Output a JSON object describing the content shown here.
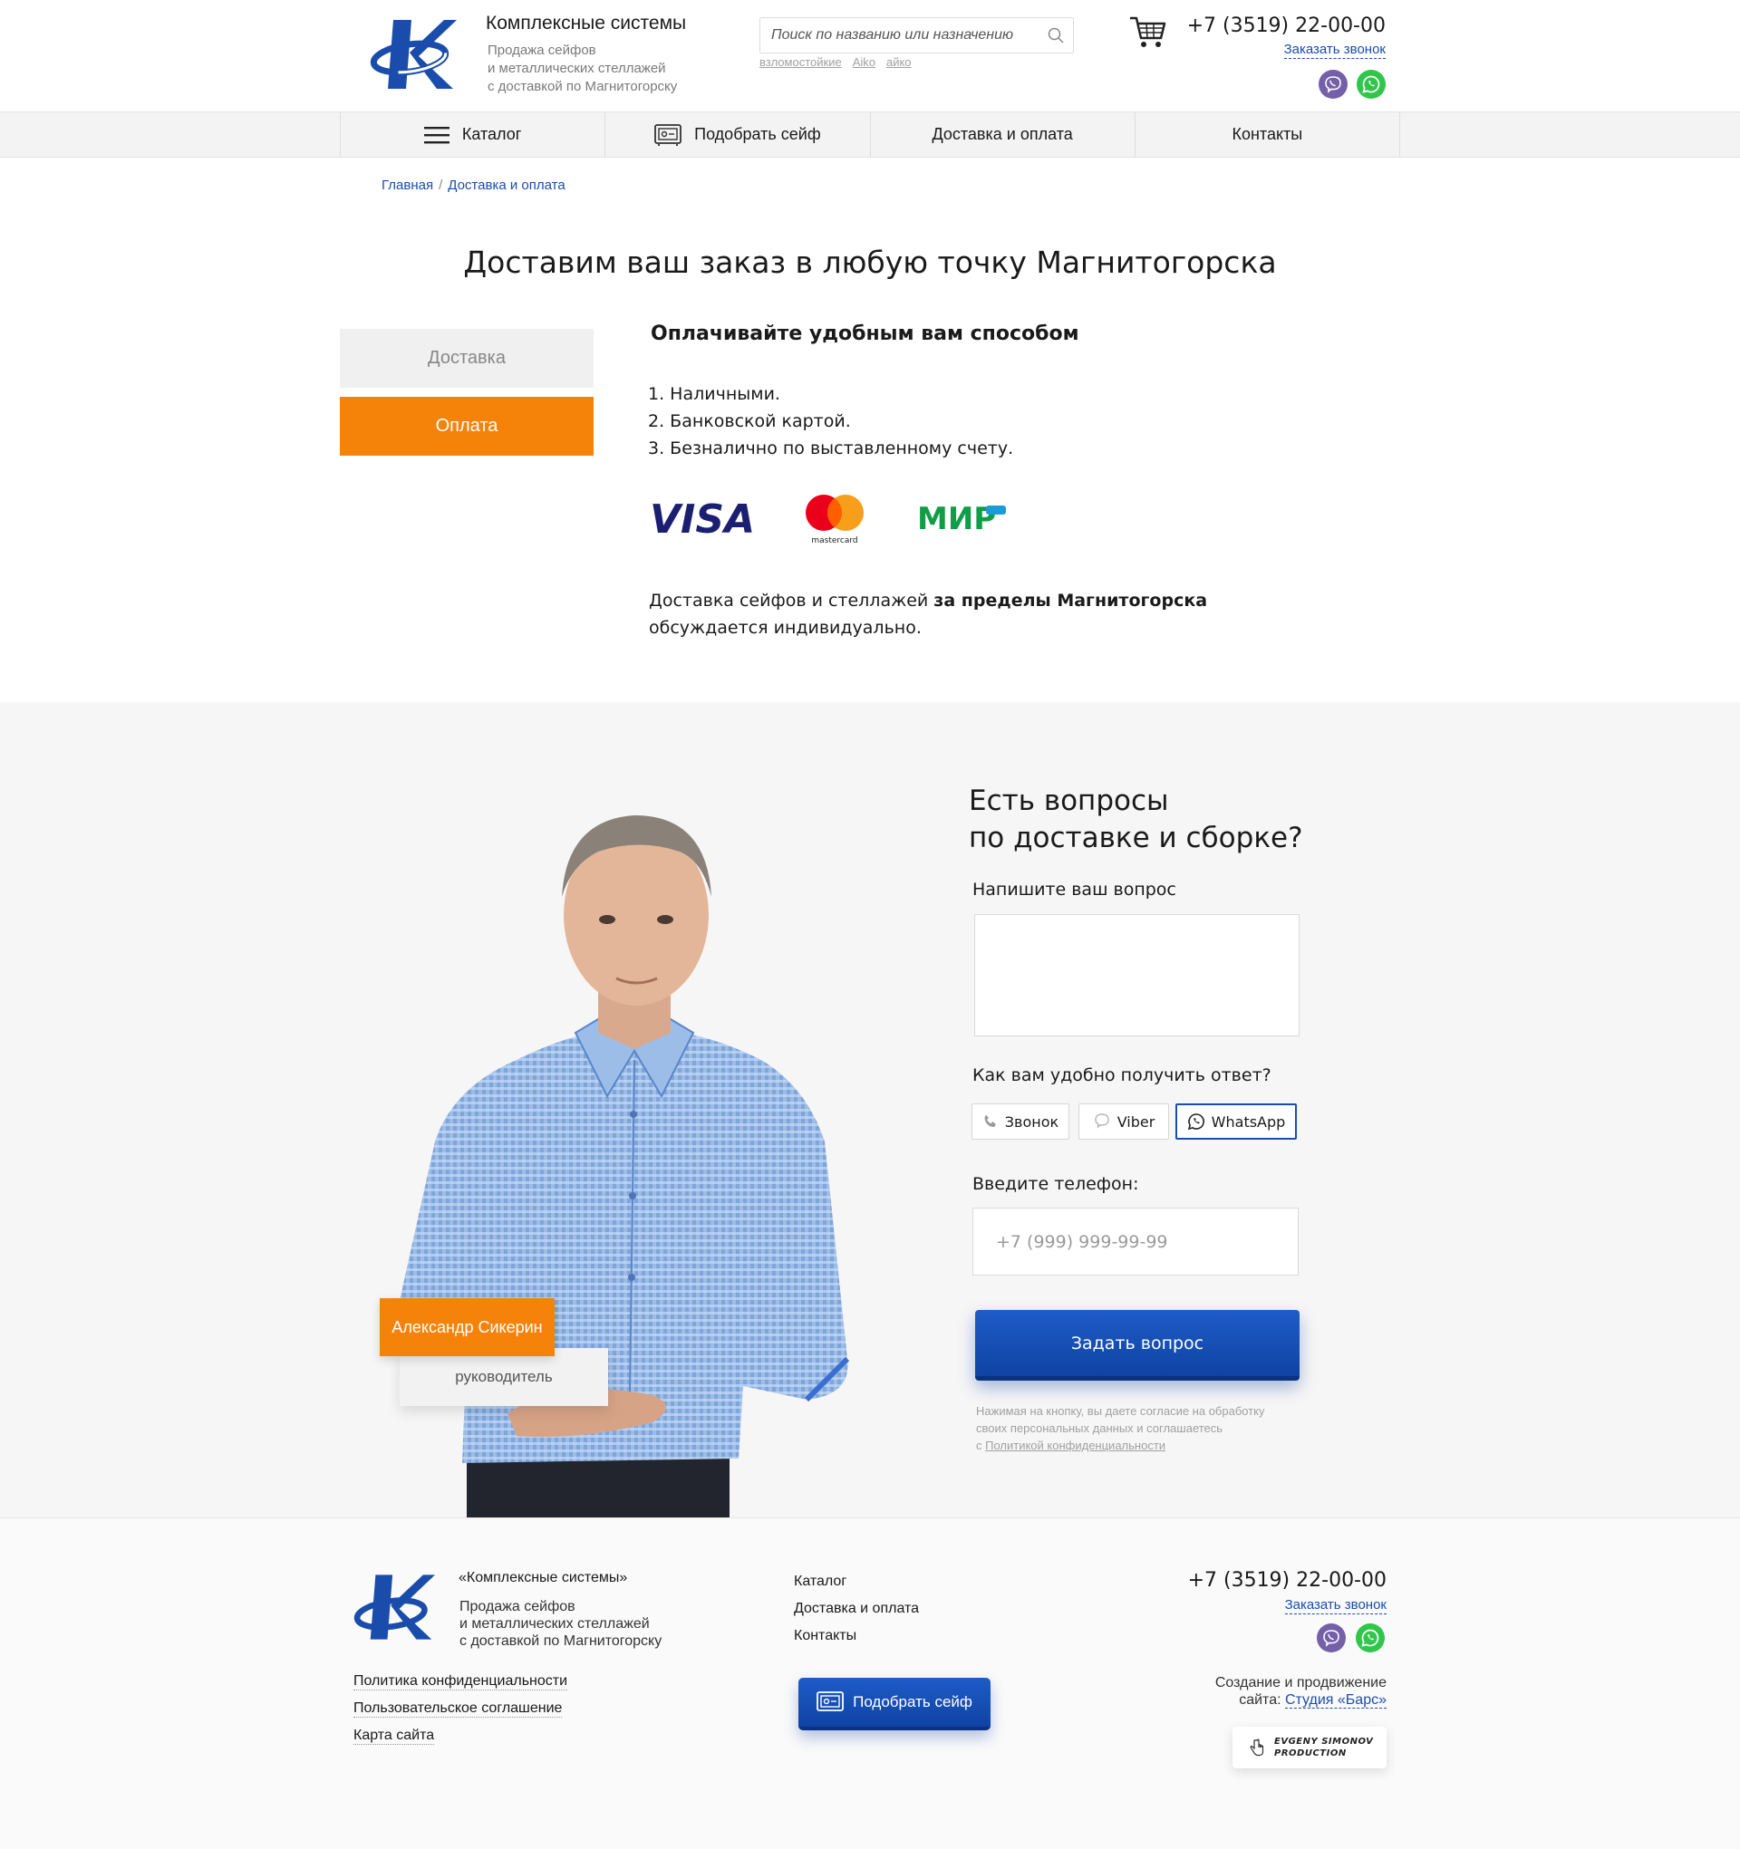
{
  "header": {
    "brand_title": "Комплексные системы",
    "brand_sub_1": "Продажа сейфов",
    "brand_sub_2": "и металлических стеллажей",
    "brand_sub_3": "с доставкой по Магнитогорску",
    "search_placeholder": "Поиск по названию или назначению",
    "search_tags": [
      "взломостойкие",
      "Aiko",
      "айко"
    ],
    "phone": "+7 (3519) 22-00-00",
    "callback": "Заказать звонок",
    "icons": [
      "logo-k",
      "search-icon",
      "cart-icon",
      "viber-icon",
      "whatsapp-icon"
    ]
  },
  "nav": {
    "catalog": "Каталог",
    "pick_safe": "Подобрать сейф",
    "delivery": "Доставка и оплата",
    "contacts": "Контакты"
  },
  "breadcrumb": {
    "home": "Главная",
    "sep": "/",
    "current": "Доставка и оплата"
  },
  "page_title": "Доставим ваш заказ в любую точку Магнитогорска",
  "tabs": {
    "delivery": "Доставка",
    "payment": "Оплата",
    "active": "payment"
  },
  "payment": {
    "heading": "Оплачивайте удобным вам способом",
    "methods": [
      "1.  Наличными.",
      "2.  Банковской картой.",
      "3.  Безналично по выставленному счету."
    ],
    "cards": {
      "visa": "VISA",
      "mastercard": "mastercard",
      "mir": "МИР"
    },
    "note_start": "Доставка сейфов и стеллажей ",
    "note_bold": "за пределы Магнитогорска",
    "note_end": "обсуждается индивидуально."
  },
  "question": {
    "title_1": "Есть вопросы",
    "title_2": "по доставке и сборке?",
    "ask_label": "Напишите ваш вопрос",
    "channel_label": "Как вам удобно получить ответ?",
    "channels": [
      "Звонок",
      "Viber",
      "WhatsApp"
    ],
    "channel_selected": "WhatsApp",
    "phone_label": "Введите телефон:",
    "phone_placeholder": "+7 (999) 999-99-99",
    "submit": "Задать вопрос",
    "consent_1": "Нажимая на кнопку, вы даете согласие на обработку",
    "consent_2": "своих персональных данных и соглашаетесь",
    "consent_3": "с ",
    "consent_link": "Политикой конфиденциальности",
    "person_name": "Александр Сикерин",
    "person_role": "руководитель"
  },
  "footer": {
    "brand": "«Комплексные системы»",
    "sub_1": "Продажа сейфов",
    "sub_2": "и металлических стеллажей",
    "sub_3": "с доставкой по Магнитогорску",
    "links": [
      "Политика конфиденциальности",
      "Пользовательское соглашение",
      "Карта сайта"
    ],
    "nav": [
      "Каталог",
      "Доставка и оплата",
      "Контакты"
    ],
    "pick_safe": "Подобрать сейф",
    "phone": "+7 (3519) 22-00-00",
    "callback": "Заказать звонок",
    "credit_1": "Создание и продвижение",
    "credit_2": "сайта: ",
    "studio": "Студия «Барс»",
    "badge_1": "EVGENY SIMONOV",
    "badge_2": "PRODUCTION"
  },
  "colors": {
    "accent_orange": "#f5830a",
    "brand_blue": "#1a4dab",
    "viber": "#7360a8",
    "whatsapp": "#2fc64b"
  }
}
